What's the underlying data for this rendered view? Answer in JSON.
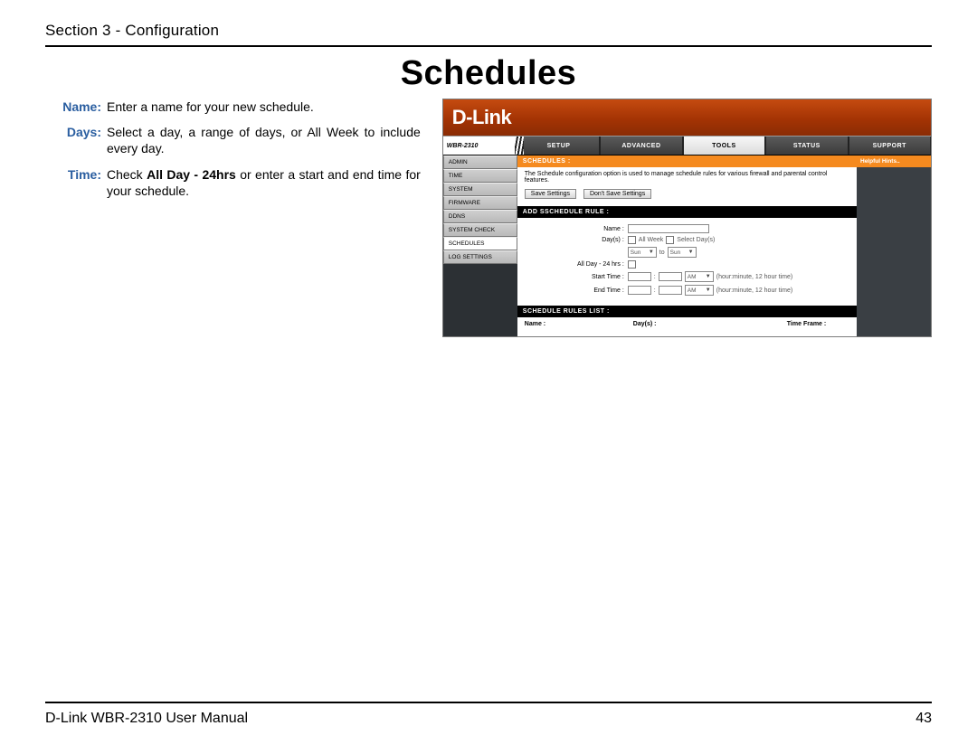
{
  "header": {
    "section": "Section 3 - Configuration"
  },
  "title": "Schedules",
  "definitions": [
    {
      "label": "Name:",
      "text_html": "Enter a name for your new schedule."
    },
    {
      "label": "Days:",
      "text_html": "Select a day, a range of days, or All Week to include every day."
    },
    {
      "label": "Time:",
      "text_html": "Check <b>All Day - 24hrs</b> or enter a start and end time for your schedule."
    }
  ],
  "screenshot": {
    "brand": "D-Link",
    "model": "WBR-2310",
    "nav_tabs": [
      "SETUP",
      "ADVANCED",
      "TOOLS",
      "STATUS",
      "SUPPORT"
    ],
    "nav_active_index": 2,
    "sidemenu": [
      "ADMIN",
      "TIME",
      "SYSTEM",
      "FIRMWARE",
      "DDNS",
      "SYSTEM CHECK",
      "SCHEDULES",
      "LOG SETTINGS"
    ],
    "sidemenu_active_index": 6,
    "hints_header": "Helpful Hints..",
    "panel_schedules": {
      "header": "SCHEDULES :",
      "desc": "The Schedule configuration option is used to manage schedule rules for various firewall and parental control features.",
      "save_btn": "Save Settings",
      "cancel_btn": "Don't Save Settings"
    },
    "panel_add": {
      "header": "ADD SSCHEDULE RULE :",
      "name_label": "Name :",
      "days_label": "Day(s) :",
      "all_week": "All Week",
      "select_days": "Select Day(s)",
      "sun_from": "Sun",
      "to": "to",
      "sun_to": "Sun",
      "allday_label": "All Day - 24 hrs :",
      "start_label": "Start Time :",
      "end_label": "End Time :",
      "colon": ":",
      "am": "AM",
      "time_hint": "(hour:minute, 12 hour time)"
    },
    "panel_list": {
      "header": "SCHEDULE RULES LIST :",
      "cols": [
        "Name :",
        "Day(s) :",
        "Time Frame :"
      ]
    }
  },
  "footer": {
    "left": "D-Link WBR-2310 User Manual",
    "right": "43"
  }
}
